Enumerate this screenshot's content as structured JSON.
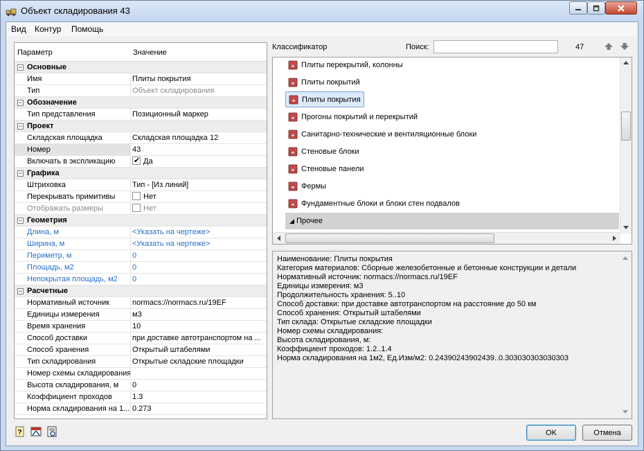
{
  "window": {
    "title": "Объект складирования 43",
    "controls": [
      "minimize-icon",
      "maximize-icon",
      "close-icon"
    ]
  },
  "menu": [
    "Вид",
    "Контур",
    "Помощь"
  ],
  "grid": {
    "headers": {
      "param": "Параметр",
      "value": "Значение"
    },
    "rows": [
      {
        "kind": "cat",
        "label": "Основные",
        "toggle": "−"
      },
      {
        "label": "Имя",
        "value": "Плиты покрытия"
      },
      {
        "label": "Тип",
        "value": "Объект складирования",
        "value_style": "gray"
      },
      {
        "kind": "cat",
        "label": "Обозначение",
        "toggle": "−"
      },
      {
        "label": "Тип представления",
        "value": "Позиционный маркер"
      },
      {
        "kind": "cat",
        "label": "Проект",
        "toggle": "−"
      },
      {
        "label": "Складская площадка",
        "value": "Складская площадка 12"
      },
      {
        "label": "Номер",
        "value": "43",
        "selected": true
      },
      {
        "label": "Включать в экспликацию",
        "value": "Да",
        "checkbox": true,
        "checked": true
      },
      {
        "kind": "cat",
        "label": "Графика",
        "toggle": "−"
      },
      {
        "label": "Штриховка",
        "value": "Тип - [Из линий]"
      },
      {
        "label": "Перекрывать примитивы",
        "value": "Нет",
        "checkbox": true,
        "checked": false
      },
      {
        "label": "Отображать размеры",
        "value": "Нет",
        "checkbox": true,
        "checked": false,
        "label_style": "gray",
        "value_style": "gray"
      },
      {
        "kind": "cat",
        "label": "Геометрия",
        "toggle": "−"
      },
      {
        "label": "Длина, м",
        "value": "<Указать на чертеже>",
        "label_style": "blue",
        "value_style": "blue"
      },
      {
        "label": "Ширина, м",
        "value": "<Указать на чертеже>",
        "label_style": "blue",
        "value_style": "blue"
      },
      {
        "label": "Периметр, м",
        "value": "0",
        "label_style": "blue",
        "value_style": "blue"
      },
      {
        "label": "Площадь, м2",
        "value": "0",
        "label_style": "blue",
        "value_style": "blue"
      },
      {
        "label": "Непокрытая площадь, м2",
        "value": "0",
        "label_style": "blue",
        "value_style": "blue"
      },
      {
        "kind": "cat",
        "label": "Расчетные",
        "toggle": "−"
      },
      {
        "label": "Нормативный источник",
        "value": "normacs://normacs.ru/19EF"
      },
      {
        "label": "Единицы измерения",
        "value": "м3"
      },
      {
        "label": "Время хранения",
        "value": "10"
      },
      {
        "label": "Способ доставки",
        "value": "при доставке автотранспортом на ..."
      },
      {
        "label": "Способ хранения",
        "value": "Открытый штабелями"
      },
      {
        "label": "Тип складирования",
        "value": "Открытые складские площадки"
      },
      {
        "label": "Номер схемы складирования",
        "value": ""
      },
      {
        "label": "Высота складирования, м",
        "value": "0"
      },
      {
        "label": "Коэффициент проходов",
        "value": "1.3"
      },
      {
        "label": "Норма складирования на 1...",
        "value": "0.273"
      }
    ]
  },
  "classifier": {
    "label": "Классификатор",
    "search_label": "Поиск:",
    "search_value": "",
    "count": "47",
    "items": [
      "Плиты перекрытий, колонны",
      "Плиты покрытий",
      "Плиты покрытия",
      "Прогоны покрытий и перекрытий",
      "Санитарно-технические и вентиляционные блоки",
      "Стеновые блоки",
      "Стеновые панели",
      "Фермы",
      "Фундаментные блоки и блоки стен подвалов"
    ],
    "selected_index": 2,
    "group": "Прочее",
    "group_arrow": "◢"
  },
  "info": [
    "Наименование: Плиты покрытия",
    "Категория материалов: Сборные железобетонные и бетонные конструкции и детали",
    "Нормативный источник: normacs://normacs.ru/19EF",
    "Единицы измерения: м3",
    "Продолжительность хранения:  5..10",
    "Способ доставки: при доставке автотранспортом на расстояние до 50 км",
    "Способ хранения: Открытый штабелями",
    "Тип склада: Открытые складские площадки",
    "Номер схемы складирования:",
    "Высота складирования, м:",
    "Коэффициент проходов:  1.2..1.4",
    "Норма складирования на 1м2, Ед.Изм/м2:  0.24390243902439..0.303030303030303"
  ],
  "buttons": {
    "ok": "OK",
    "cancel": "Отмена"
  },
  "colors": {
    "link_blue": "#2a6fc9",
    "disabled_gray": "#8a8a8a",
    "selection": "#dcebfc"
  }
}
